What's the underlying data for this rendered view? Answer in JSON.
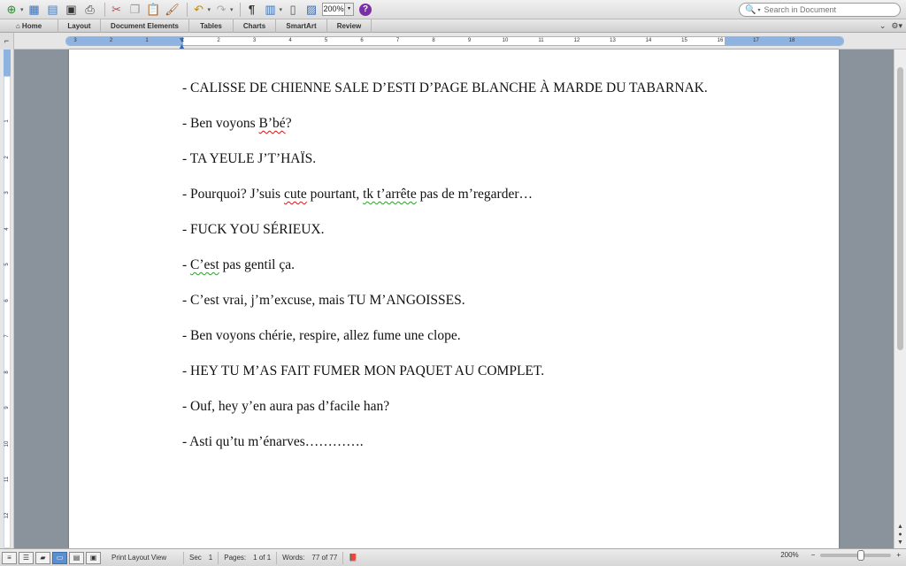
{
  "toolbar": {
    "zoom_value": "200%",
    "icons": [
      "new-icon",
      "gallery-icon",
      "open-icon",
      "save-icon",
      "print-icon",
      "cut-icon",
      "copy-icon",
      "paste-icon",
      "format-painter-icon",
      "undo-icon",
      "redo-icon",
      "pilcrow-icon",
      "sidebar-icon",
      "navigation-icon",
      "media-browser-icon",
      "help-icon"
    ]
  },
  "search": {
    "placeholder": "Search in Document"
  },
  "ribbon": {
    "tabs": [
      {
        "label": "Home"
      },
      {
        "label": "Layout"
      },
      {
        "label": "Document Elements"
      },
      {
        "label": "Tables"
      },
      {
        "label": "Charts"
      },
      {
        "label": "SmartArt"
      },
      {
        "label": "Review"
      }
    ]
  },
  "ruler": {
    "numbers": [
      "3",
      "2",
      "1",
      "1",
      "2",
      "3",
      "4",
      "5",
      "6",
      "7",
      "8",
      "9",
      "10",
      "11",
      "12",
      "13",
      "14",
      "15",
      "16",
      "17",
      "18"
    ]
  },
  "vruler": {
    "numbers": [
      "1",
      "2",
      "3",
      "4",
      "5",
      "6",
      "7",
      "8",
      "9",
      "10",
      "11",
      "12"
    ]
  },
  "document": {
    "lines": [
      {
        "text": "- CALISSE DE CHIENNE SALE D’ESTI D’PAGE BLANCHE À MARDE DU TABARNAK."
      },
      {
        "pre": "- Ben voyons ",
        "spell": "B’bé",
        "post": "?"
      },
      {
        "text": "- TA YEULE J’T’HAÏS."
      },
      {
        "pre": "- Pourquoi? J’suis ",
        "spell": "cute",
        "mid": " pourtant, ",
        "gram": "tk t’arrête",
        "post": " pas de m’regarder…"
      },
      {
        "text": "- FUCK YOU SÉRIEUX."
      },
      {
        "pre": "- ",
        "gram": "C’est",
        "post": " pas gentil ça."
      },
      {
        "text": "- C’est vrai, j’m’excuse, mais TU M’ANGOISSES."
      },
      {
        "text": "- Ben voyons chérie, respire, allez fume une clope."
      },
      {
        "text": "- HEY TU M’AS FAIT FUMER MON PAQUET AU COMPLET."
      },
      {
        "text": "- Ouf, hey y’en aura pas d’facile han?"
      },
      {
        "text": "- Asti qu’tu m’énarves…………."
      }
    ]
  },
  "status": {
    "view": "Print Layout View",
    "sec_label": "Sec",
    "sec_value": "1",
    "pages_label": "Pages:",
    "pages_value": "1 of 1",
    "words_label": "Words:",
    "words_value": "77 of 77",
    "zoom": "200%"
  }
}
